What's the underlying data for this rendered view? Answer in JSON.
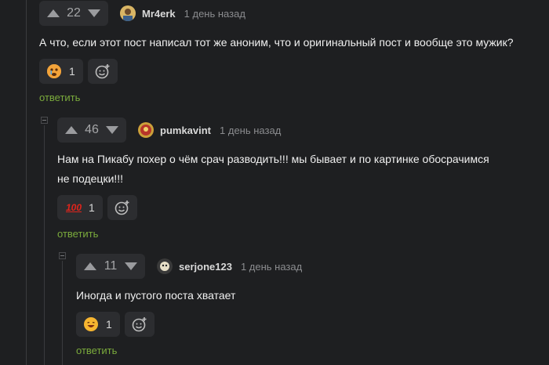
{
  "comments": [
    {
      "rating": "22",
      "author": "Mr4erk",
      "time": "1 день назад",
      "text": "А что, если этот пост написал тот же аноним, что и оригинальный пост и вообще это мужик?",
      "reaction": {
        "icon": "crying-face-icon",
        "count": "1"
      },
      "reply": "ответить"
    },
    {
      "rating": "46",
      "author": "pumkavint",
      "time": "1 день назад",
      "text_line1": "Нам на Пикабу похер о чём срач разводить!!! мы бывает и по картинке обосрачимся",
      "text_line2": "не подецки!!!",
      "reaction": {
        "icon": "hundred-points-icon",
        "label": "100",
        "count": "1"
      },
      "reply": "ответить"
    },
    {
      "rating": "11",
      "author": "serjone123",
      "time": "1 день назад",
      "text": "Иногда и пустого поста хватает",
      "reaction": {
        "icon": "laughing-face-icon",
        "count": "1"
      },
      "reply": "ответить"
    }
  ],
  "colors": {
    "background": "#1e1f21",
    "reply_link": "#7bab3c",
    "hundred": "#e0241b"
  }
}
